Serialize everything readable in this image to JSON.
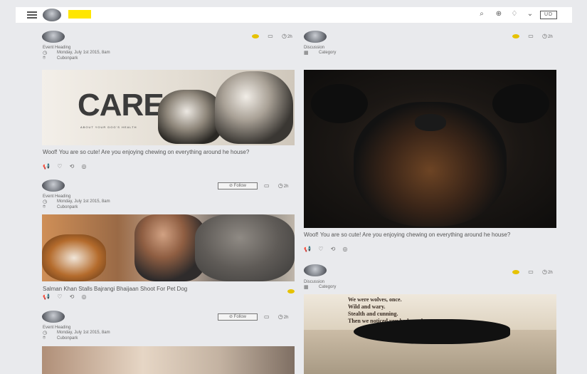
{
  "topbar": {
    "icons": [
      "menu-icon",
      "avatar",
      "logo-mark",
      "search-icon",
      "add-icon",
      "bell-icon",
      "chevron-down-icon"
    ],
    "badge_text": "UD"
  },
  "posts": [
    {
      "id": "p1",
      "column": "left",
      "heading": "Event Heading",
      "datetime": "Monday, July 1st 2015, 8am",
      "location": "Cubonpark",
      "time_ago": "2h",
      "image_text": {
        "title": "CARE",
        "subtitle": "ABOUT YOUR DOG'S HEALTH"
      },
      "caption": "Woof! You are so cute! Are you enjoying chewing on everything around he house?",
      "actions": [
        "megaphone-icon",
        "heart-icon",
        "repeat-icon",
        "comment-icon"
      ]
    },
    {
      "id": "p2",
      "column": "left",
      "heading": "Event Heading",
      "datetime": "Monday, July 1st 2015, 8am",
      "location": "Cubonpark",
      "follow_label": "Follow",
      "time_ago": "2h",
      "caption": "Salman Khan Stalls Bajrangi Bhaijaan Shoot For Pet Dog",
      "actions": [
        "megaphone-icon",
        "heart-icon",
        "repeat-icon",
        "comment-icon"
      ]
    },
    {
      "id": "p3",
      "column": "left",
      "heading": "Event Heading",
      "datetime": "Monday, July 1st 2015, 8am",
      "location": "Cubonpark",
      "follow_label": "Follow",
      "time_ago": "2h"
    },
    {
      "id": "p4",
      "column": "right",
      "heading": "Discussion",
      "category": "Category",
      "time_ago": "2h",
      "caption": "Woof! You are so cute! Are you enjoying chewing on everything around he house?",
      "actions": [
        "megaphone-icon",
        "heart-icon",
        "repeat-icon",
        "comment-icon"
      ]
    },
    {
      "id": "p5",
      "column": "right",
      "heading": "Discussion",
      "category": "Category",
      "time_ago": "2h",
      "image_text": {
        "quote_lines": [
          "We were wolves, once.",
          "Wild and wary.",
          "Stealth and cunning.",
          "Then we noticed you had couches."
        ]
      }
    }
  ],
  "colors": {
    "accent": "#e6c200",
    "logo": "#ffe600",
    "background": "#e9eaed"
  }
}
